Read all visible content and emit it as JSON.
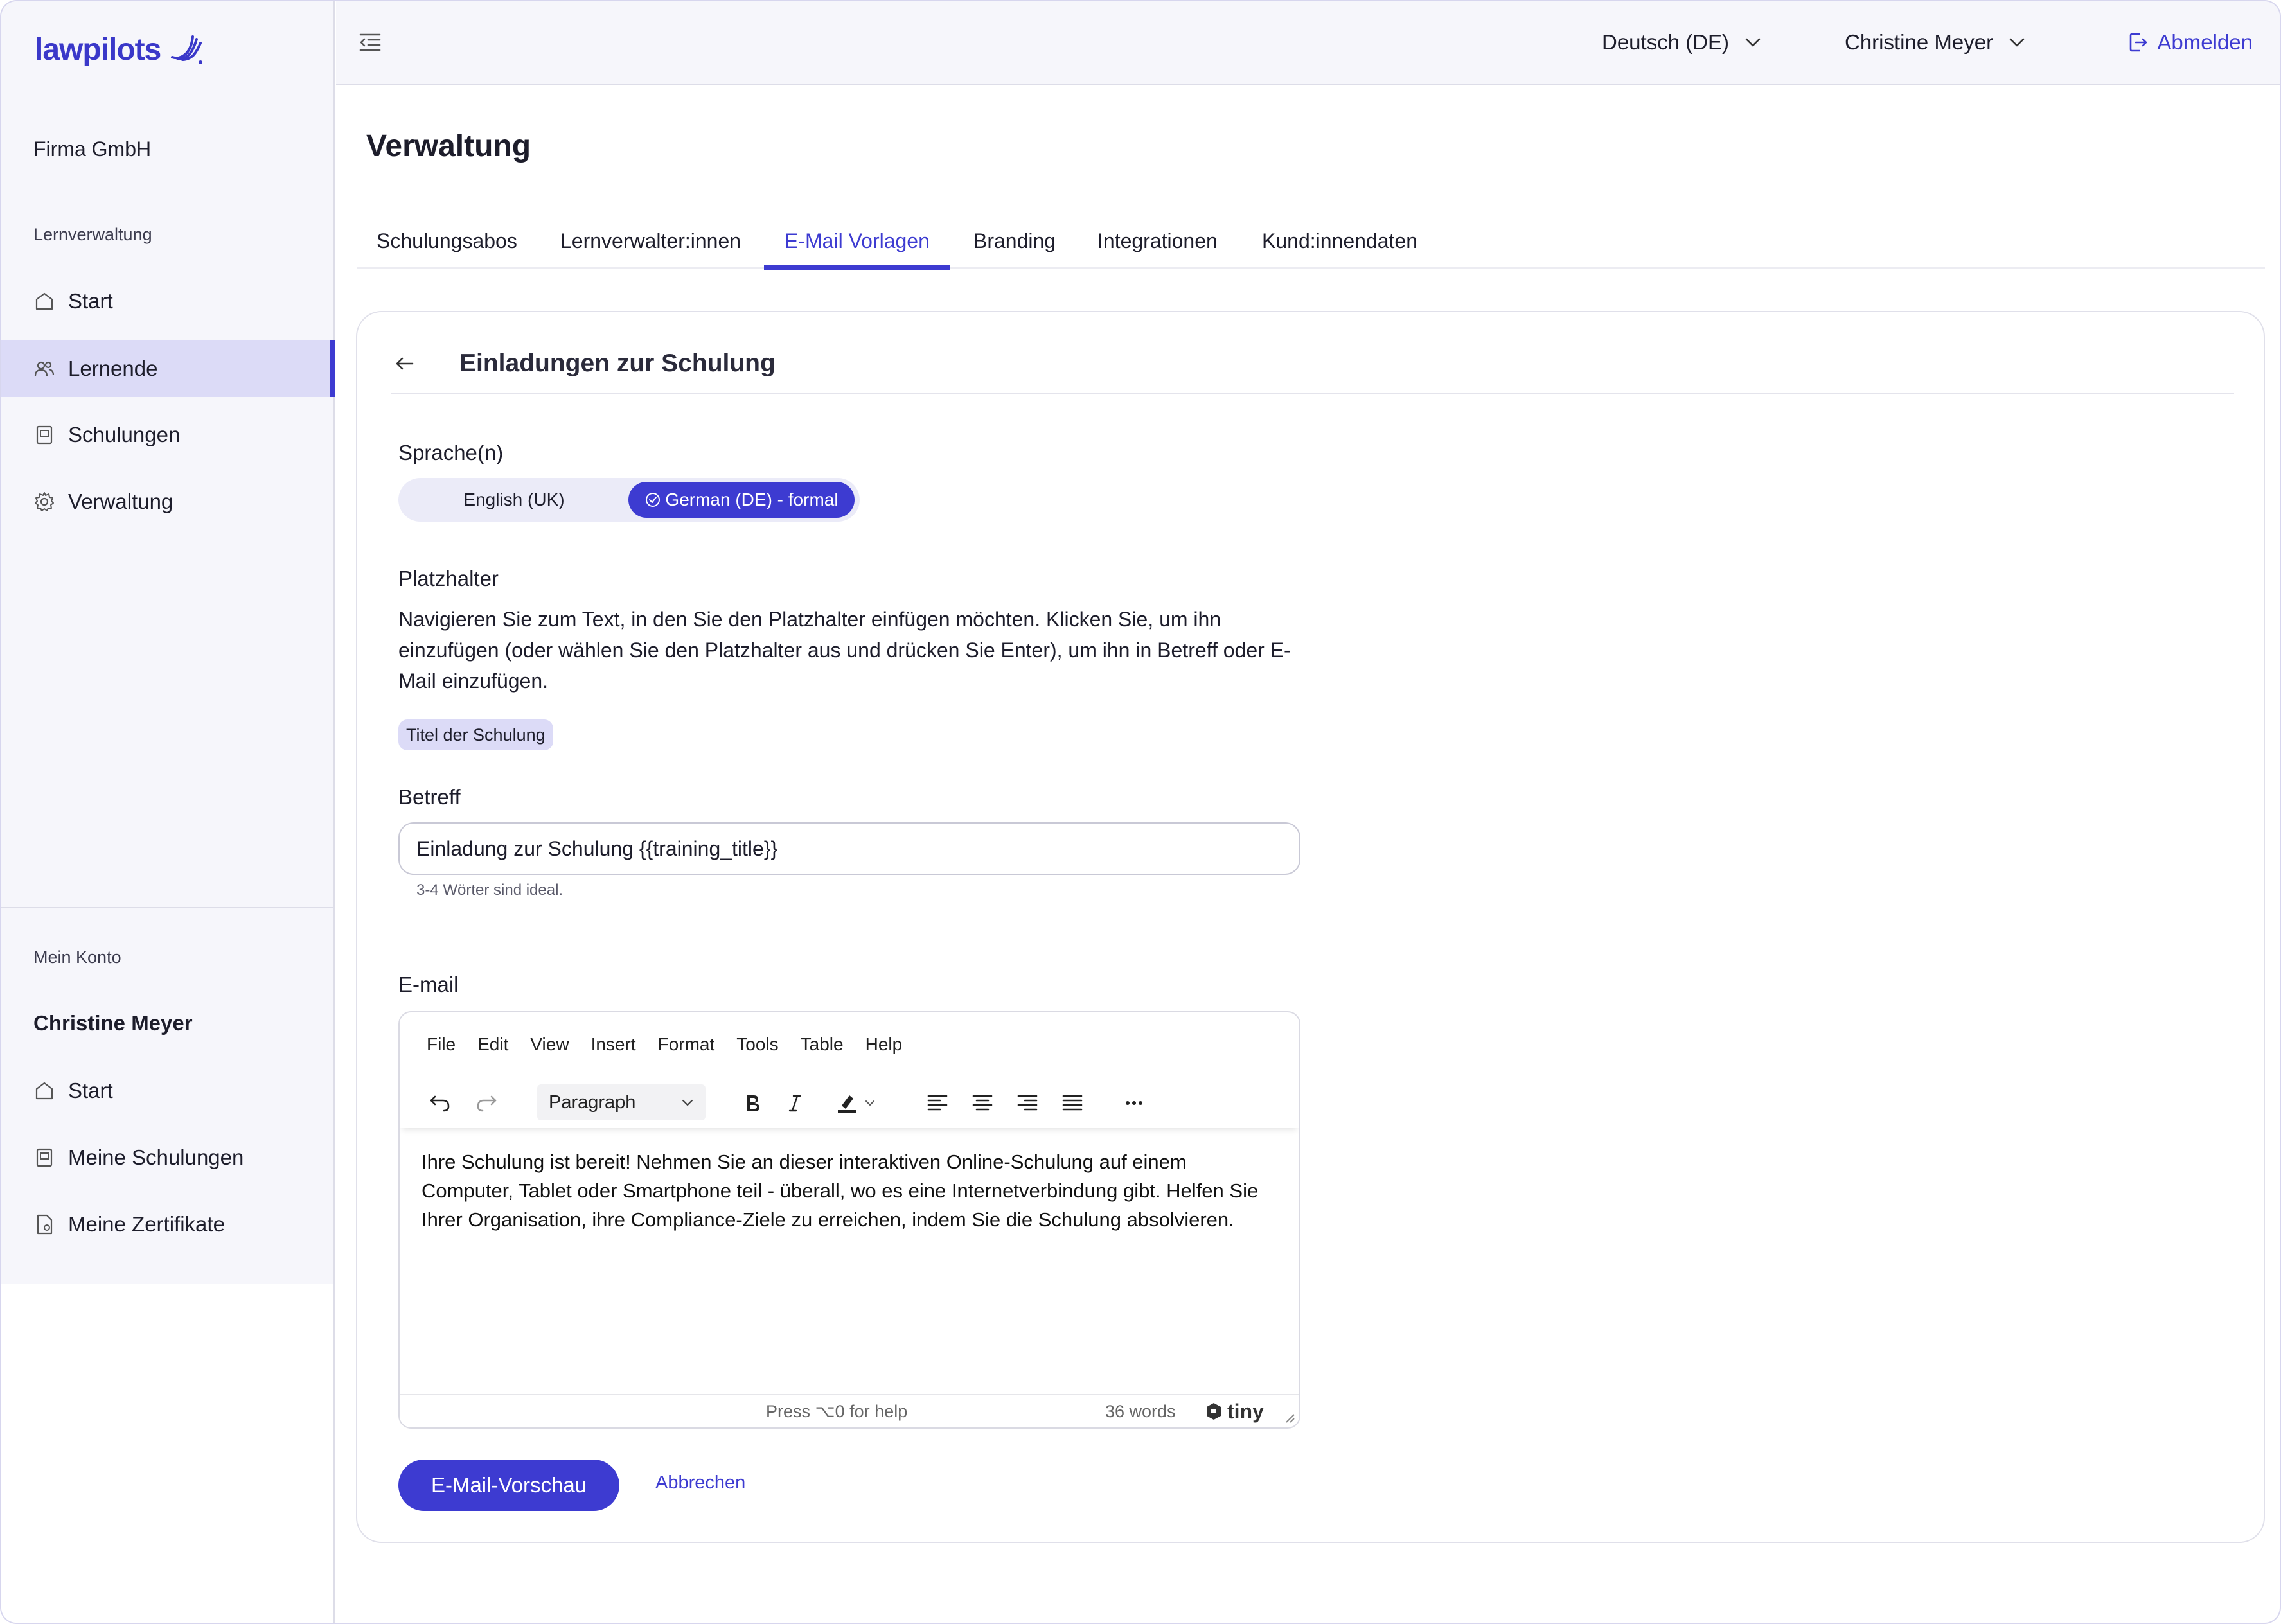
{
  "app": {
    "logo_text": "lawpilots"
  },
  "sidebar": {
    "org_name": "Firma GmbH",
    "section_label": "Lernverwaltung",
    "items": [
      {
        "label": "Start",
        "icon": "home-icon"
      },
      {
        "label": "Lernende",
        "icon": "users-icon",
        "active": true
      },
      {
        "label": "Schulungen",
        "icon": "book-icon"
      },
      {
        "label": "Verwaltung",
        "icon": "gear-icon"
      }
    ],
    "account_label": "Mein Konto",
    "account_name": "Christine Meyer",
    "account_items": [
      {
        "label": "Start",
        "icon": "home-icon"
      },
      {
        "label": "Meine Schulungen",
        "icon": "book-icon"
      },
      {
        "label": "Meine Zertifikate",
        "icon": "certificate-icon"
      }
    ]
  },
  "topbar": {
    "language": "Deutsch (DE)",
    "user": "Christine Meyer",
    "logout": "Abmelden"
  },
  "main": {
    "title": "Verwaltung",
    "tabs": [
      {
        "label": "Schulungsabos"
      },
      {
        "label": "Lernverwalter:innen"
      },
      {
        "label": "E-Mail Vorlagen",
        "active": true
      },
      {
        "label": "Branding"
      },
      {
        "label": "Integrationen"
      },
      {
        "label": "Kund:innendaten"
      }
    ]
  },
  "card": {
    "title": "Einladungen zur Schulung",
    "languages_label": "Sprache(n)",
    "languages": [
      {
        "label": "English (UK)",
        "selected": false
      },
      {
        "label": "German (DE) - formal",
        "selected": true
      }
    ],
    "placeholder_label": "Platzhalter",
    "placeholder_help": "Navigieren Sie zum Text, in den Sie den Platzhalter einfügen möchten. Klicken Sie, um ihn einzufügen (oder wählen Sie den Platzhalter aus und drücken Sie Enter), um ihn in Betreff oder E-Mail einzufügen.",
    "placeholder_chip": "Titel der Schulung",
    "subject_label": "Betreff",
    "subject_value": "Einladung zur Schulung {{training_title}}",
    "subject_hint": "3-4 Wörter sind ideal.",
    "email_label": "E-mail",
    "editor": {
      "menu": [
        "File",
        "Edit",
        "View",
        "Insert",
        "Format",
        "Tools",
        "Table",
        "Help"
      ],
      "block_format": "Paragraph",
      "body": "Ihre Schulung ist bereit! Nehmen Sie an dieser interaktiven Online-Schulung auf einem Computer, Tablet oder Smartphone teil - überall, wo es eine Internetverbindung gibt. Helfen Sie Ihrer Organisation, ihre Compliance-Ziele zu erreichen, indem Sie die Schulung absolvieren.",
      "status_help": "Press ⌥0 for help",
      "word_count": "36 words",
      "brand": "tiny"
    },
    "preview_button": "E-Mail-Vorschau",
    "cancel_button": "Abbrechen"
  },
  "colors": {
    "accent": "#3d3bd1",
    "active_bg": "#dcdbf7",
    "sidebar_bg": "#f6f6fb"
  }
}
